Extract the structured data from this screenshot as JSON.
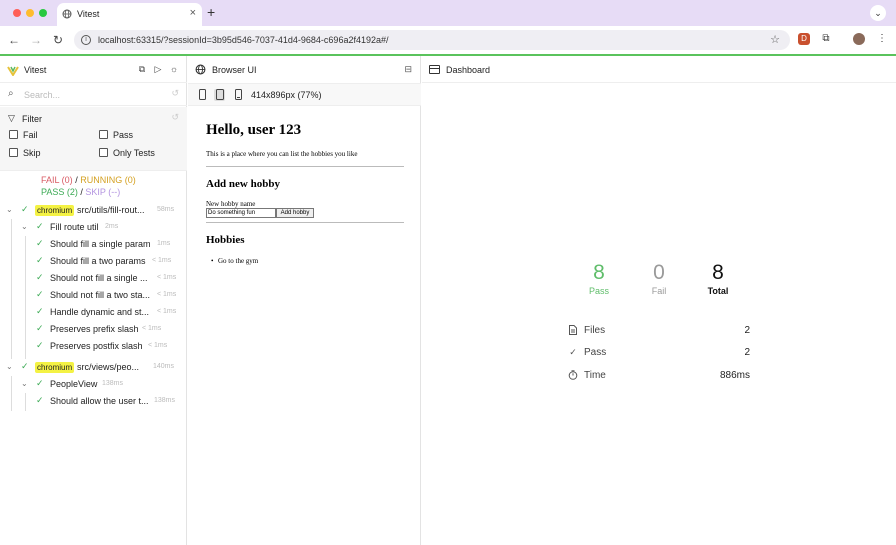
{
  "browser": {
    "tab_title": "Vitest",
    "url": "localhost:63315/?sessionId=3b95d546-7037-41d4-9684-c696a2f4192a#/",
    "colors": {
      "close": "#ff5f57",
      "minimize": "#febc2e",
      "zoom": "#28c840",
      "accent_line": "#5ac35c"
    }
  },
  "sidebar": {
    "title": "Vitest",
    "search_placeholder": "Search...",
    "filter_label": "Filter",
    "filters": {
      "fail": "Fail",
      "pass": "Pass",
      "skip": "Skip",
      "only_tests": "Only Tests"
    },
    "summary": {
      "fail": "FAIL (0)",
      "sep1": "/",
      "running": "RUNNING (0)",
      "pass": "PASS (2)",
      "sep2": "/",
      "skip": "SKIP (--)"
    },
    "tree": [
      {
        "badge": "chromium",
        "name": "src/utils/fill-rout...",
        "time": "58ms"
      },
      {
        "name": "Fill route util",
        "time": "2ms"
      },
      {
        "name": "Should fill a single param",
        "time": "1ms"
      },
      {
        "name": "Should fill a two params",
        "time": "< 1ms"
      },
      {
        "name": "Should not fill a single ...",
        "time": "< 1ms"
      },
      {
        "name": "Should not fill a two sta...",
        "time": "< 1ms"
      },
      {
        "name": "Handle dynamic and st...",
        "time": "< 1ms"
      },
      {
        "name": "Preserves prefix slash",
        "time": "< 1ms"
      },
      {
        "name": "Preserves postfix slash",
        "time": "< 1ms"
      },
      {
        "badge": "chromium",
        "name": "src/views/peo...",
        "time": "140ms"
      },
      {
        "name": "PeopleView",
        "time": "138ms"
      },
      {
        "name": "Should allow the user t...",
        "time": "138ms"
      }
    ]
  },
  "browser_ui": {
    "title": "Browser UI",
    "viewport": "414x896px (77%)",
    "page": {
      "heading": "Hello, user 123",
      "intro": "This is a place where you can list the hobbies you like",
      "add_heading": "Add new hobby",
      "input_label": "New hobby name",
      "input_value": "Do something fun",
      "add_button": "Add hobby",
      "hobbies_heading": "Hobbies",
      "hobbies": [
        "Go to the gym"
      ]
    }
  },
  "dashboard": {
    "title": "Dashboard",
    "pass_count": "8",
    "pass_label": "Pass",
    "fail_count": "0",
    "fail_label": "Fail",
    "total_count": "8",
    "total_label": "Total",
    "rows": [
      {
        "icon": "file-icon",
        "label": "Files",
        "value": "2"
      },
      {
        "icon": "check-icon",
        "label": "Pass",
        "value": "2"
      },
      {
        "icon": "timer-icon",
        "label": "Time",
        "value": "886ms"
      }
    ],
    "colors": {
      "pass": "#5fbd6a",
      "fail": "#9a9a9a",
      "total": "#111111"
    }
  }
}
